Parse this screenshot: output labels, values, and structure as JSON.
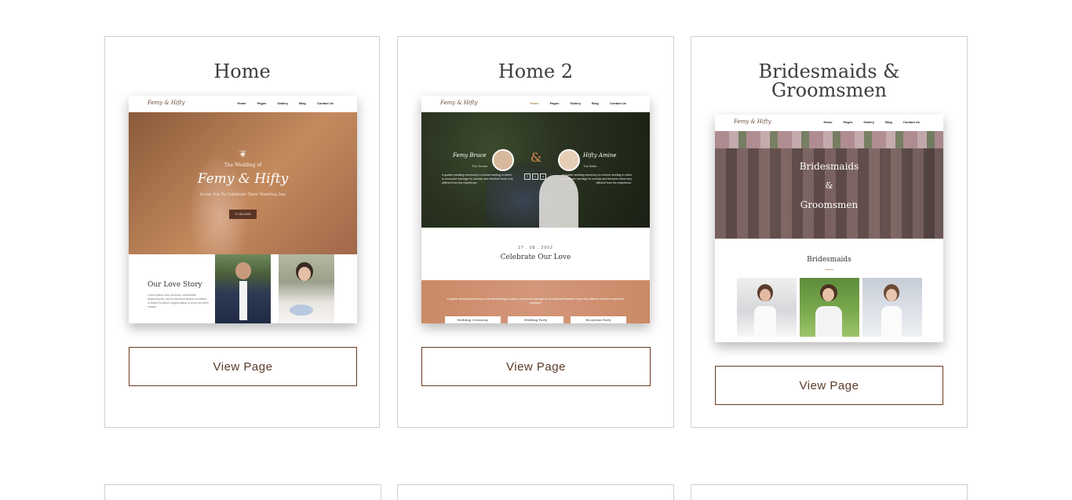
{
  "cards": [
    {
      "title": "Home",
      "button": "View Page",
      "preview": {
        "logo": "Femy & Hifty",
        "nav": [
          "Home",
          "Pages",
          "Gallery",
          "Blog",
          "Contact Us"
        ],
        "hero_kicker": "The Wedding of",
        "hero_names": "Femy & Hifty",
        "hero_sub": "Invite You To Celebrate Their Wedding Day",
        "hero_date": "27.08.2020",
        "story_title": "Our Love Story",
        "story_text": "Lorem ipsum dolor sit amet, consectetur adipiscing elit, sed do eiusmod tempor incididunt ut labore et dolore magna aliqua ut enim ad minim veniam."
      }
    },
    {
      "title": "Home 2",
      "button": "View Page",
      "preview": {
        "logo": "Femy & Hifty",
        "nav": [
          "Home",
          "Pages",
          "Gallery",
          "Blog",
          "Contact Us"
        ],
        "groom_name": "Femy Bruce",
        "groom_role": "The Groom",
        "bride_name": "Hifty Amine",
        "bride_role": "The Bride",
        "groom_text": "A quarter wedding ceremony is a formal meeting in which to announce marriage for worship and therefore show very different from the experience.",
        "bride_text": "A quarter wedding ceremony is a formal meeting in which to announce marriage for worship and therefore show very different from the experience.",
        "date": "27 . 08 . 2002",
        "celebrate": "Celebrate Our Love",
        "band_text": "A quarter wedding ceremony is a formal meeting in which to announce marriage for worship and therefore show very different from the experience expected.",
        "tabs": [
          "Wedding Ceremony",
          "Wedding Party",
          "Reception Party"
        ]
      }
    },
    {
      "title": "Bridesmaids &\nGroomsmen",
      "button": "View Page",
      "preview": {
        "logo": "Femy & Hifty",
        "nav": [
          "Home",
          "Pages",
          "Gallery",
          "Blog",
          "Contact Us"
        ],
        "hero_line1": "Bridesmaids",
        "hero_line2": "&",
        "hero_line3": "Groomsmen",
        "section_title": "Bridesmaids"
      }
    }
  ],
  "colors": {
    "border": "#cfcfcf",
    "accent": "#6b3a1e",
    "title": "#3d3d3d"
  }
}
